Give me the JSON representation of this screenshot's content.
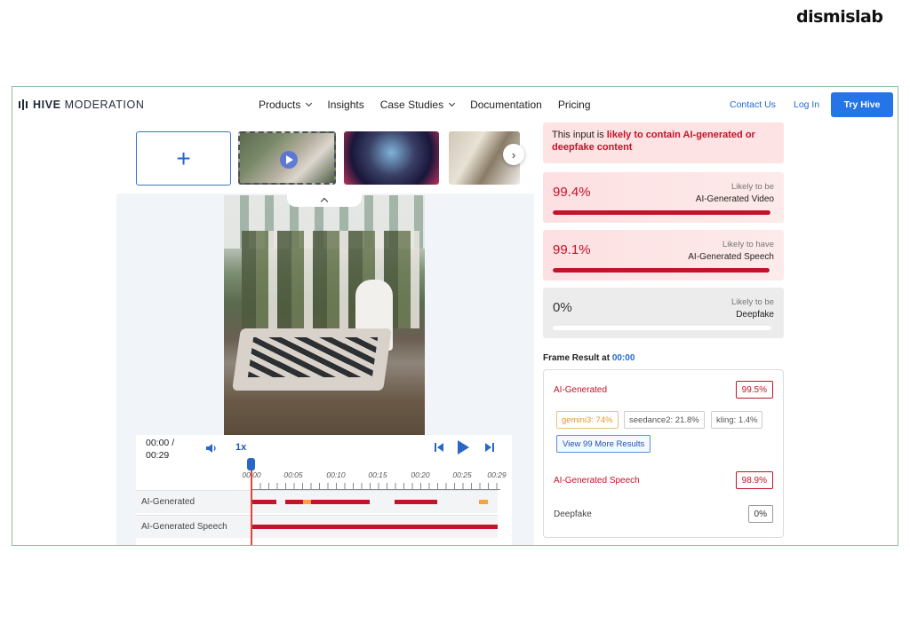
{
  "watermark": "dismislab",
  "nav": {
    "logo_bold": "HIVE",
    "logo_light": " MODERATION",
    "menu": [
      {
        "label": "Products",
        "dropdown": true
      },
      {
        "label": "Insights",
        "dropdown": false
      },
      {
        "label": "Case Studies",
        "dropdown": true
      },
      {
        "label": "Documentation",
        "dropdown": false
      },
      {
        "label": "Pricing",
        "dropdown": false
      }
    ],
    "contact": "Contact Us",
    "login": "Log In",
    "try": "Try Hive"
  },
  "upload": {
    "plus": "+"
  },
  "player": {
    "time": "00:00 / 00:29",
    "speed": "1x",
    "ticks": [
      "00:00",
      "00:05",
      "00:10",
      "00:15",
      "00:20",
      "00:25",
      "00:29"
    ],
    "tracks": [
      {
        "label": "AI-Generated"
      },
      {
        "label": "AI-Generated Speech"
      }
    ]
  },
  "result": {
    "alert_prefix": "This input is ",
    "alert_highlight": "likely to contain AI-generated or deepfake content",
    "cards": [
      {
        "pct": "99.4%",
        "likely": "Likely to be",
        "category": "AI-Generated Video",
        "value": 99.4
      },
      {
        "pct": "99.1%",
        "likely": "Likely to have",
        "category": "AI-Generated Speech",
        "value": 99.1
      },
      {
        "pct": "0%",
        "likely": "Likely to be",
        "category": "Deepfake",
        "value": 0
      }
    ],
    "frame_label": "Frame Result at ",
    "frame_time": "00:00",
    "rows": {
      "ai_generated": {
        "label": "AI-Generated",
        "score": "99.5%"
      },
      "chips": [
        "gemini3: 74%",
        "seedance2: 21.8%",
        "kling: 1.4%"
      ],
      "more": "View 99 More Results",
      "speech": {
        "label": "AI-Generated Speech",
        "score": "98.9%"
      },
      "deepfake": {
        "label": "Deepfake",
        "score": "0%"
      }
    }
  },
  "colors": {
    "accent": "#2574e8",
    "danger": "#c4122a",
    "warning": "#f3a53a"
  }
}
